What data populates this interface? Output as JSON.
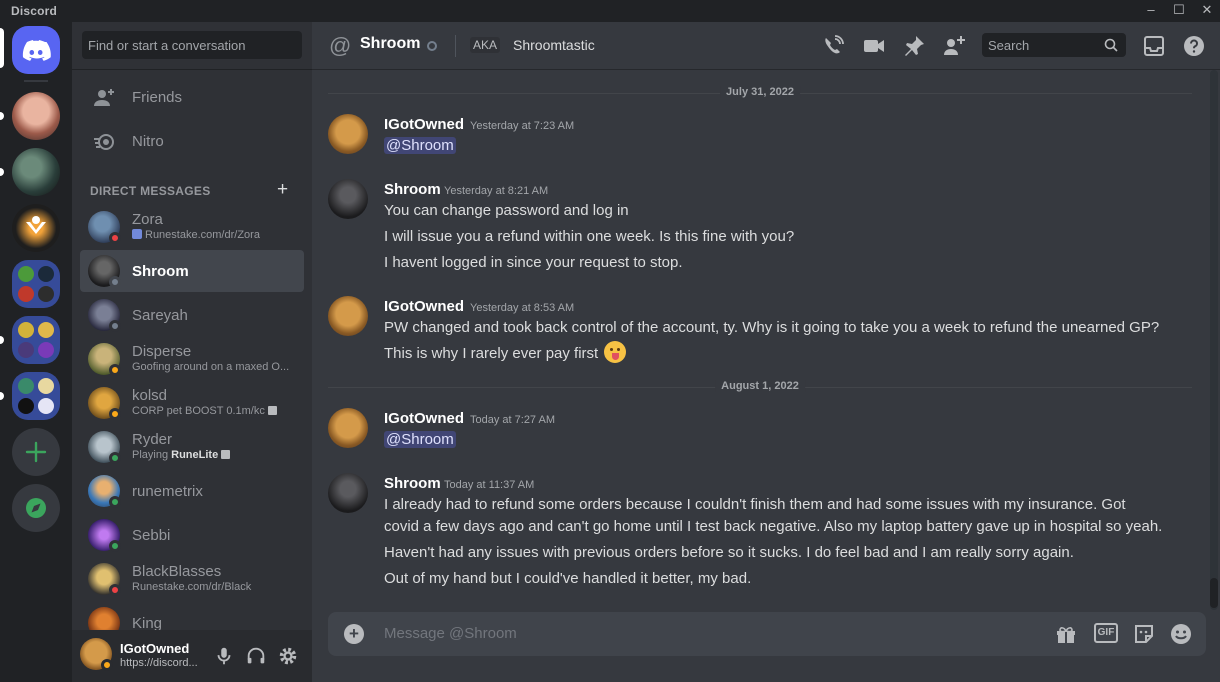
{
  "app": {
    "brand": "Discord"
  },
  "window": {
    "minimize": "–",
    "maximize": "☐",
    "close": "✕"
  },
  "sidebar": {
    "search_placeholder": "Find or start a conversation",
    "nav": [
      {
        "label": "Friends"
      },
      {
        "label": "Nitro"
      }
    ],
    "dm_header": "DIRECT MESSAGES",
    "dm_add": "+",
    "dms": [
      {
        "name": "Zora",
        "sub": "Runestake.com/dr/Zora",
        "status": "dnd"
      },
      {
        "name": "Shroom",
        "sub": "",
        "status": "offline"
      },
      {
        "name": "Sareyah",
        "sub": "",
        "status": "offline"
      },
      {
        "name": "Disperse",
        "sub": "Goofing around on a maxed O...",
        "status": "idle"
      },
      {
        "name": "kolsd",
        "sub": "CORP pet BOOST 0.1m/kc",
        "status": "idle"
      },
      {
        "name": "Ryder",
        "sub_prefix": "Playing ",
        "sub_bold": "RuneLite",
        "status": "online"
      },
      {
        "name": "runemetrix",
        "sub": "",
        "status": "online"
      },
      {
        "name": "Sebbi",
        "sub": "",
        "status": "online"
      },
      {
        "name": "BlackBlasses",
        "sub": "Runestake.com/dr/Black",
        "status": "dnd"
      },
      {
        "name": "King",
        "sub": "",
        "status": "none"
      }
    ]
  },
  "user_panel": {
    "name": "IGotOwned",
    "sub": "https://discord..."
  },
  "channel": {
    "at": "@",
    "name": "Shroom",
    "aka_label": "AKA",
    "aka_name": "Shroomtastic",
    "search_placeholder": "Search"
  },
  "messages": {
    "date1": "July 31, 2022",
    "date2": "August 1, 2022",
    "groups": [
      {
        "author": "IGotOwned",
        "time": "Yesterday at 7:23 AM",
        "lines": [
          "@Shroom"
        ]
      },
      {
        "author": "Shroom",
        "time": "Yesterday at 8:21 AM",
        "lines": [
          "You can change password and log in",
          "I will issue you a refund within one week. Is this fine with you?",
          "I havent logged in since your request to stop."
        ]
      },
      {
        "author": "IGotOwned",
        "time": "Yesterday at 8:53 AM",
        "lines": [
          "PW changed and took back control of the account, ty. Why is it going to take you a week to refund the unearned GP?",
          "This is why I rarely ever pay first"
        ]
      },
      {
        "author": "IGotOwned",
        "time": "Today at 7:27 AM",
        "lines": [
          "@Shroom"
        ]
      },
      {
        "author": "Shroom",
        "time": "Today at 11:37 AM",
        "lines": [
          "I already had to refund some orders because I couldn't finish them and had some issues with my insurance. Got",
          "covid a few days ago and can't go home until I test back negative. Also my laptop battery gave up in hospital so yeah.",
          "Haven't had any issues with previous orders before so it sucks. I do feel bad and I am really sorry again.",
          "Out of my hand but I could've handled it better, my bad."
        ]
      }
    ]
  },
  "composer": {
    "placeholder": "Message @Shroom",
    "gif": "GIF"
  },
  "colors": {
    "accent": "#5865f2",
    "online": "#3ba55d",
    "idle": "#faa81a",
    "dnd": "#ed4245",
    "offline": "#747f8d"
  }
}
